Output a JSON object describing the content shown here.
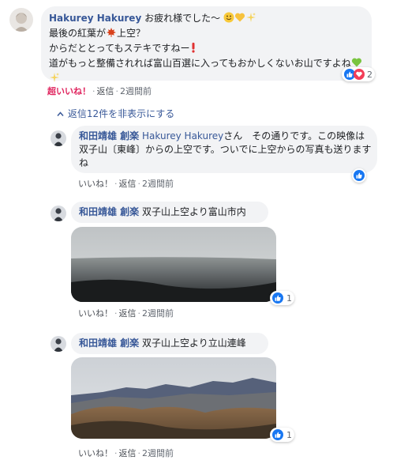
{
  "comment_main": {
    "author": "Hakurey Hakurey",
    "line1": "お疲れ様でした～",
    "line2_a": "最後の紅葉が",
    "line2_b": "上空？",
    "line3": "からだととってもステキですねー",
    "line4": "道がもっと整備されれば富山百選に入ってもおかしくないお山ですよね",
    "reaction_count": "2",
    "actions": {
      "super_like": "超いいね！",
      "reply": "返信",
      "time": "2週間前"
    },
    "icons": [
      "smile-emoji",
      "yellow-heart-emoji",
      "sparkles-emoji",
      "maple-leaf-emoji",
      "exclamation-emoji",
      "green-heart-emoji",
      "sparkles-emoji"
    ]
  },
  "hide_replies": {
    "label": "返信12件を非表示にする"
  },
  "replies": [
    {
      "author": "和田靖雄 創楽",
      "mention": "Hakurey Hakurey",
      "text_after_mention": "さん　その通りです。この映像は双子山〔東峰〕からの上空です。ついでに上空からの写真も送りますね",
      "reaction_count": "",
      "actions": {
        "like": "いいね！",
        "reply": "返信",
        "time": "2週間前"
      }
    },
    {
      "author": "和田靖雄 創楽",
      "text": "双子山上空より富山市内",
      "reaction_count": "1",
      "actions": {
        "like": "いいね！",
        "reply": "返信",
        "time": "2週間前"
      }
    },
    {
      "author": "和田靖雄 創楽",
      "text": "双子山上空より立山連峰",
      "reaction_count": "1",
      "actions": {
        "like": "いいね！",
        "reply": "返信",
        "time": "2週間前"
      }
    }
  ],
  "colors": {
    "accent": "#385898",
    "bubble": "#f2f3f5",
    "like_blue": "#1877f2",
    "love_red": "#f33e58",
    "super_like": "#e0245e"
  }
}
